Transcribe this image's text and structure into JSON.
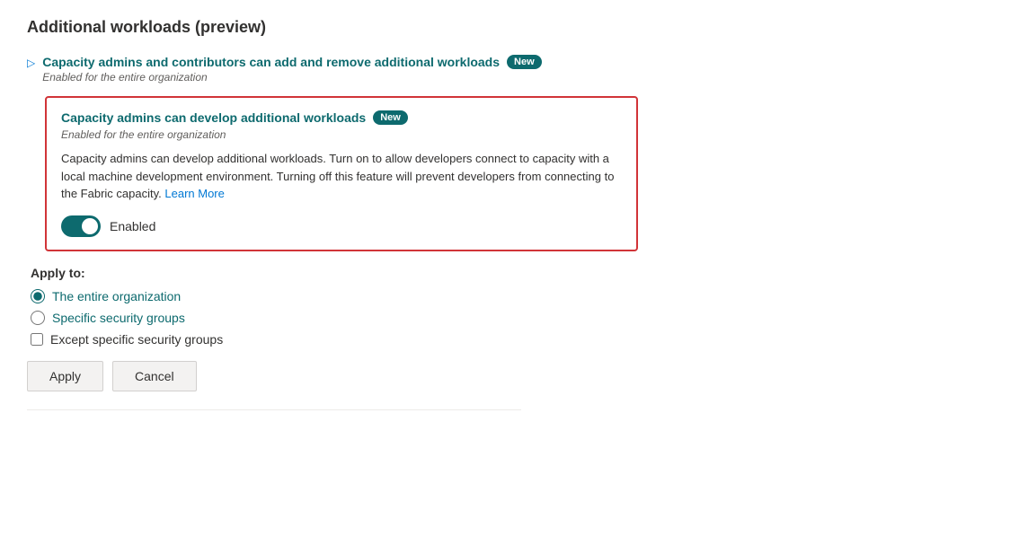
{
  "page": {
    "title": "Additional workloads (preview)"
  },
  "workloads": [
    {
      "id": "item1",
      "title": "Capacity admins and contributors can add and remove additional workloads",
      "badge": "New",
      "subtitle": "Enabled for the entire organization",
      "expanded": false,
      "chevron_collapsed": "▷"
    },
    {
      "id": "item2",
      "title": "Capacity admins can develop additional workloads",
      "badge": "New",
      "subtitle": "Enabled for the entire organization",
      "expanded": true,
      "chevron_expanded": "◁",
      "description_part1": "Capacity admins can develop additional workloads. Turn on to allow developers connect to capacity with a local machine development environment. Turning off this feature will prevent developers from connecting to the Fabric capacity.",
      "learn_more_label": "Learn More",
      "toggle_state": true,
      "toggle_label": "Enabled"
    }
  ],
  "apply_to": {
    "title": "Apply to:",
    "options": [
      {
        "id": "entire-org",
        "label": "The entire organization",
        "selected": true
      },
      {
        "id": "specific-groups",
        "label": "Specific security groups",
        "selected": false
      }
    ],
    "checkbox": {
      "label": "Except specific security groups",
      "checked": false
    }
  },
  "buttons": {
    "apply_label": "Apply",
    "cancel_label": "Cancel"
  }
}
